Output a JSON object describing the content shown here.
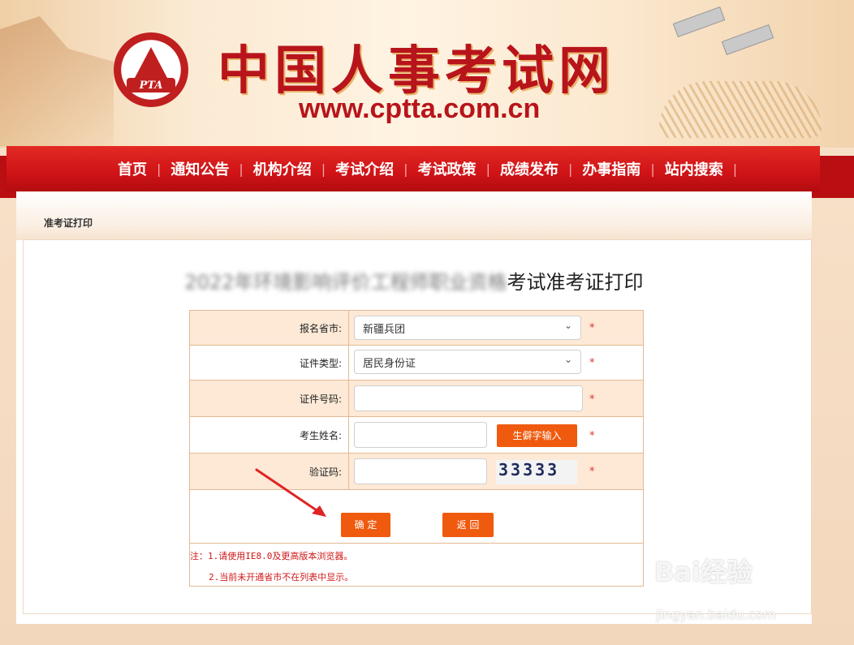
{
  "site": {
    "title": "中国人事考试网",
    "url": "www.cptta.com.cn",
    "logo_text": "PTA"
  },
  "nav": {
    "items": [
      "首页",
      "通知公告",
      "机构介绍",
      "考试介绍",
      "考试政策",
      "成绩发布",
      "办事指南",
      "站内搜索"
    ]
  },
  "breadcrumb": "准考证打印",
  "page": {
    "title_blurred": "2022年环境影响评价工程师职业资格",
    "title_visible": "考试准考证打印"
  },
  "form": {
    "province_label": "报名省市:",
    "province_value": "新疆兵团",
    "idtype_label": "证件类型:",
    "idtype_value": "居民身份证",
    "idnum_label": "证件号码:",
    "name_label": "考生姓名:",
    "rare_char_button": "生僻字输入",
    "captcha_label": "验证码:",
    "captcha_text": "33333",
    "required_mark": "*",
    "confirm_button": "确 定",
    "back_button": "返 回",
    "note_1": "注：1.请使用IE8.0及更高版本浏览器。",
    "note_2": "2.当前未开通省市不在列表中显示。"
  },
  "watermark": {
    "brand": "Bai经验",
    "domain": "jingyan.baidu.com"
  },
  "colors": {
    "brand_red": "#b8141b",
    "nav_red": "#cf1317",
    "button_orange": "#f05a0e",
    "row_tint": "#fde9d6"
  }
}
